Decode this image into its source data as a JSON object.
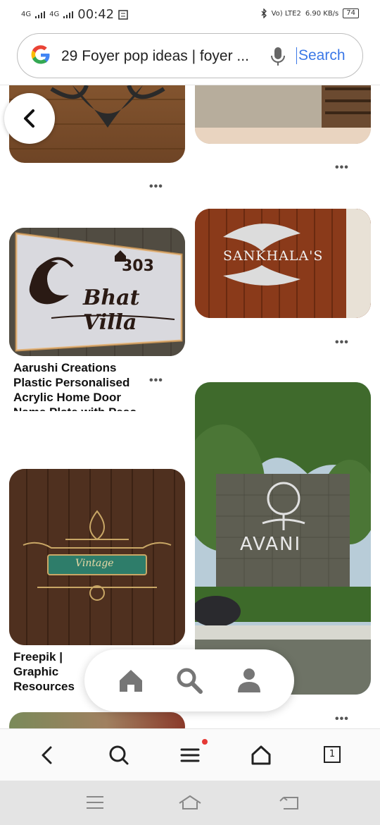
{
  "status_bar": {
    "network_1": "4G",
    "network_2": "4G",
    "time": "00:42",
    "volte": "Vo) LTE2",
    "speed": "6.90 KB/s",
    "battery": "74"
  },
  "url_bar": {
    "text": "29 Foyer pop ideas | foyer ...",
    "search_label": "Search"
  },
  "pins": [
    {
      "id": "pin-top-left",
      "title": ""
    },
    {
      "id": "pin-top-right",
      "title": ""
    },
    {
      "id": "pin-bhat-villa",
      "sign_text": "Bhat Villa",
      "house_number": "303",
      "title": "Aarushi Creations Plastic Personalised Acrylic Home Door Name Plate with Peac"
    },
    {
      "id": "pin-sankhala",
      "sign_text": "SANKHALA'S",
      "title": ""
    },
    {
      "id": "pin-vintage",
      "sign_text": "Vintage",
      "title": "Freepik | Graphic Resources for everyone"
    },
    {
      "id": "pin-avani",
      "sign_text": "AVANI",
      "title": ""
    }
  ],
  "more_label": "•••",
  "colors": {
    "accent_blue": "#3b78e7",
    "notification_dot": "#e53935"
  },
  "icons": {
    "back": "chevron-left-icon",
    "home": "home-icon",
    "search": "search-icon",
    "profile": "profile-icon",
    "browser_back": "arrow-left-icon",
    "browser_search": "search-icon",
    "browser_menu": "menu-icon",
    "browser_home": "home-outline-icon",
    "tabs_count": "1"
  }
}
